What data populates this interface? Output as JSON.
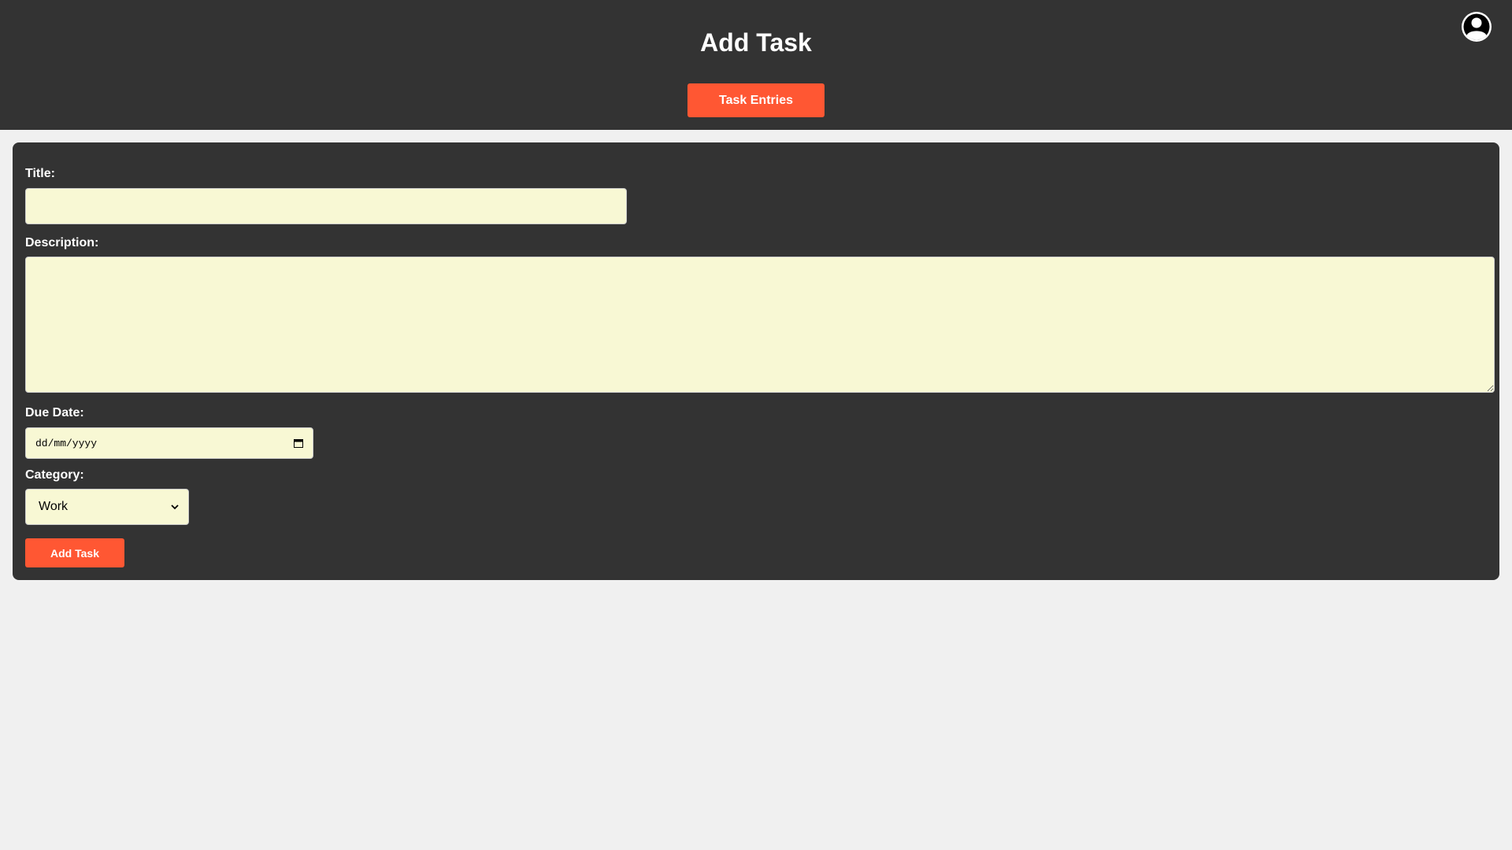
{
  "header": {
    "title": "Add Task",
    "nav_button_label": "Task Entries",
    "profile_icon": "user-circle-icon"
  },
  "form": {
    "title_label": "Title:",
    "title_value": "",
    "description_label": "Description:",
    "description_value": "",
    "due_date_label": "Due Date:",
    "due_date_placeholder": "dd/mm/yyyy",
    "calendar_icon": "calendar-icon",
    "category_label": "Category:",
    "category_selected": "Work",
    "select_icon": "chevron-down-icon",
    "submit_label": "Add Task"
  },
  "colors": {
    "header_bg": "#333333",
    "accent": "#ff5733",
    "field_bg": "#f8f8d4",
    "page_bg": "#f0f0f0"
  }
}
